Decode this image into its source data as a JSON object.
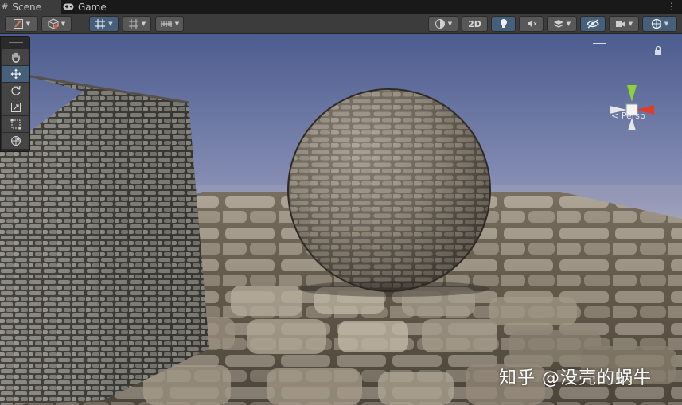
{
  "tabs": [
    {
      "label": "Scene",
      "icon": "hash-icon",
      "active": true
    },
    {
      "label": "Game",
      "icon": "gamepad-icon",
      "active": false
    }
  ],
  "toolbar": {
    "mode_2d_label": "2D"
  },
  "tools": [
    {
      "name": "hand-tool",
      "icon": "hand-icon",
      "selected": false
    },
    {
      "name": "move-tool",
      "icon": "move-icon",
      "selected": true
    },
    {
      "name": "rotate-tool",
      "icon": "rotate-icon",
      "selected": false
    },
    {
      "name": "scale-tool",
      "icon": "scale-icon",
      "selected": false
    },
    {
      "name": "rect-tool",
      "icon": "rect-icon",
      "selected": false
    },
    {
      "name": "transform-tool",
      "icon": "transform-icon",
      "selected": false
    }
  ],
  "gizmo": {
    "projection_label": "Persp"
  },
  "watermark": "知乎 @没壳的蜗牛",
  "colors": {
    "selected": "#46607c",
    "toolbar_bg": "#3c3c3c",
    "tab_bg": "#191919",
    "gizmo_y": "#8ed23a",
    "gizmo_x": "#e03c2a"
  }
}
